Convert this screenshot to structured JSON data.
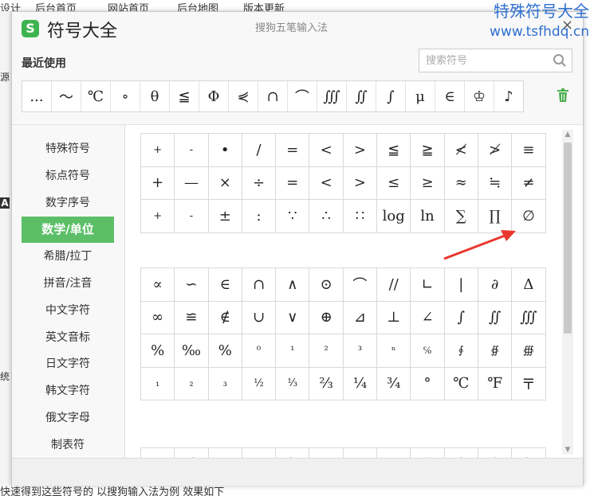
{
  "background": {
    "top_text": [
      "设计",
      "后台首页",
      "网站首页",
      "后台地图",
      "版本更新"
    ],
    "left_text": [
      "源",
      "A",
      "统"
    ],
    "bottom_text": "快速得到这些符号的 以搜狗输入法为例 效果如下"
  },
  "watermark": {
    "line1": "特殊符号大全",
    "line2": "www.tsfhdq.cn"
  },
  "dialog": {
    "logo": "S",
    "title": "符号大全",
    "subtitle": "搜狗五笔输入法",
    "close": "×",
    "recent_label": "最近使用",
    "search_placeholder": "搜索符号",
    "recent_symbols": [
      "...",
      "～",
      "℃",
      "∘",
      "θ",
      "≦",
      "Φ",
      "⋞",
      "∩",
      "⌒",
      "∭",
      "∬",
      "∫",
      "μ",
      "∈",
      "♔",
      "♪"
    ]
  },
  "categories": {
    "items": [
      "特殊符号",
      "标点符号",
      "数字序号",
      "数学/单位",
      "希腊/拉丁",
      "拼音/注音",
      "中文字符",
      "英文音标",
      "日文字符",
      "韩文字符",
      "俄文字母",
      "制表符"
    ],
    "active": "数学/单位"
  },
  "grid1": [
    "+",
    "-",
    "•",
    "/",
    "=",
    "<",
    ">",
    "≦",
    "≧",
    "≮",
    "≯",
    "≡",
    "+",
    "—",
    "×",
    "÷",
    "=",
    "<",
    ">",
    "≤",
    "≥",
    "≈",
    "≒",
    "≠",
    "+",
    "-",
    "±",
    ":",
    "∵",
    "∴",
    "∷",
    "log",
    "ln",
    "∑",
    "∏",
    "∅"
  ],
  "grid2": [
    "∝",
    "∽",
    "∈",
    "∩",
    "∧",
    "⊙",
    "⌒",
    "//",
    "∟",
    "|",
    "∂",
    "Δ",
    "∞",
    "≌",
    "∉",
    "∪",
    "∨",
    "⊕",
    "⊿",
    "⊥",
    "∠",
    "∫",
    "∬",
    "∭",
    "%",
    "‰",
    "%",
    "⁰",
    "¹",
    "²",
    "³",
    "ⁿ",
    "℅",
    "∮",
    "∯",
    "∰",
    "₁",
    "₂",
    "₃",
    "½",
    "⅓",
    "⅔",
    "¼",
    "¾",
    "°",
    "℃",
    "℉",
    "〒"
  ],
  "grid3": [
    "·",
    "ˊ",
    "ˉ",
    "˘",
    "ˋ",
    "'",
    "‘",
    "’",
    "ˇ",
    "˄",
    "ˆ",
    "ˋ"
  ],
  "colors": {
    "accent": "#5cbf68",
    "watermark": "#2f6fd0",
    "arrow": "#e8382d"
  }
}
